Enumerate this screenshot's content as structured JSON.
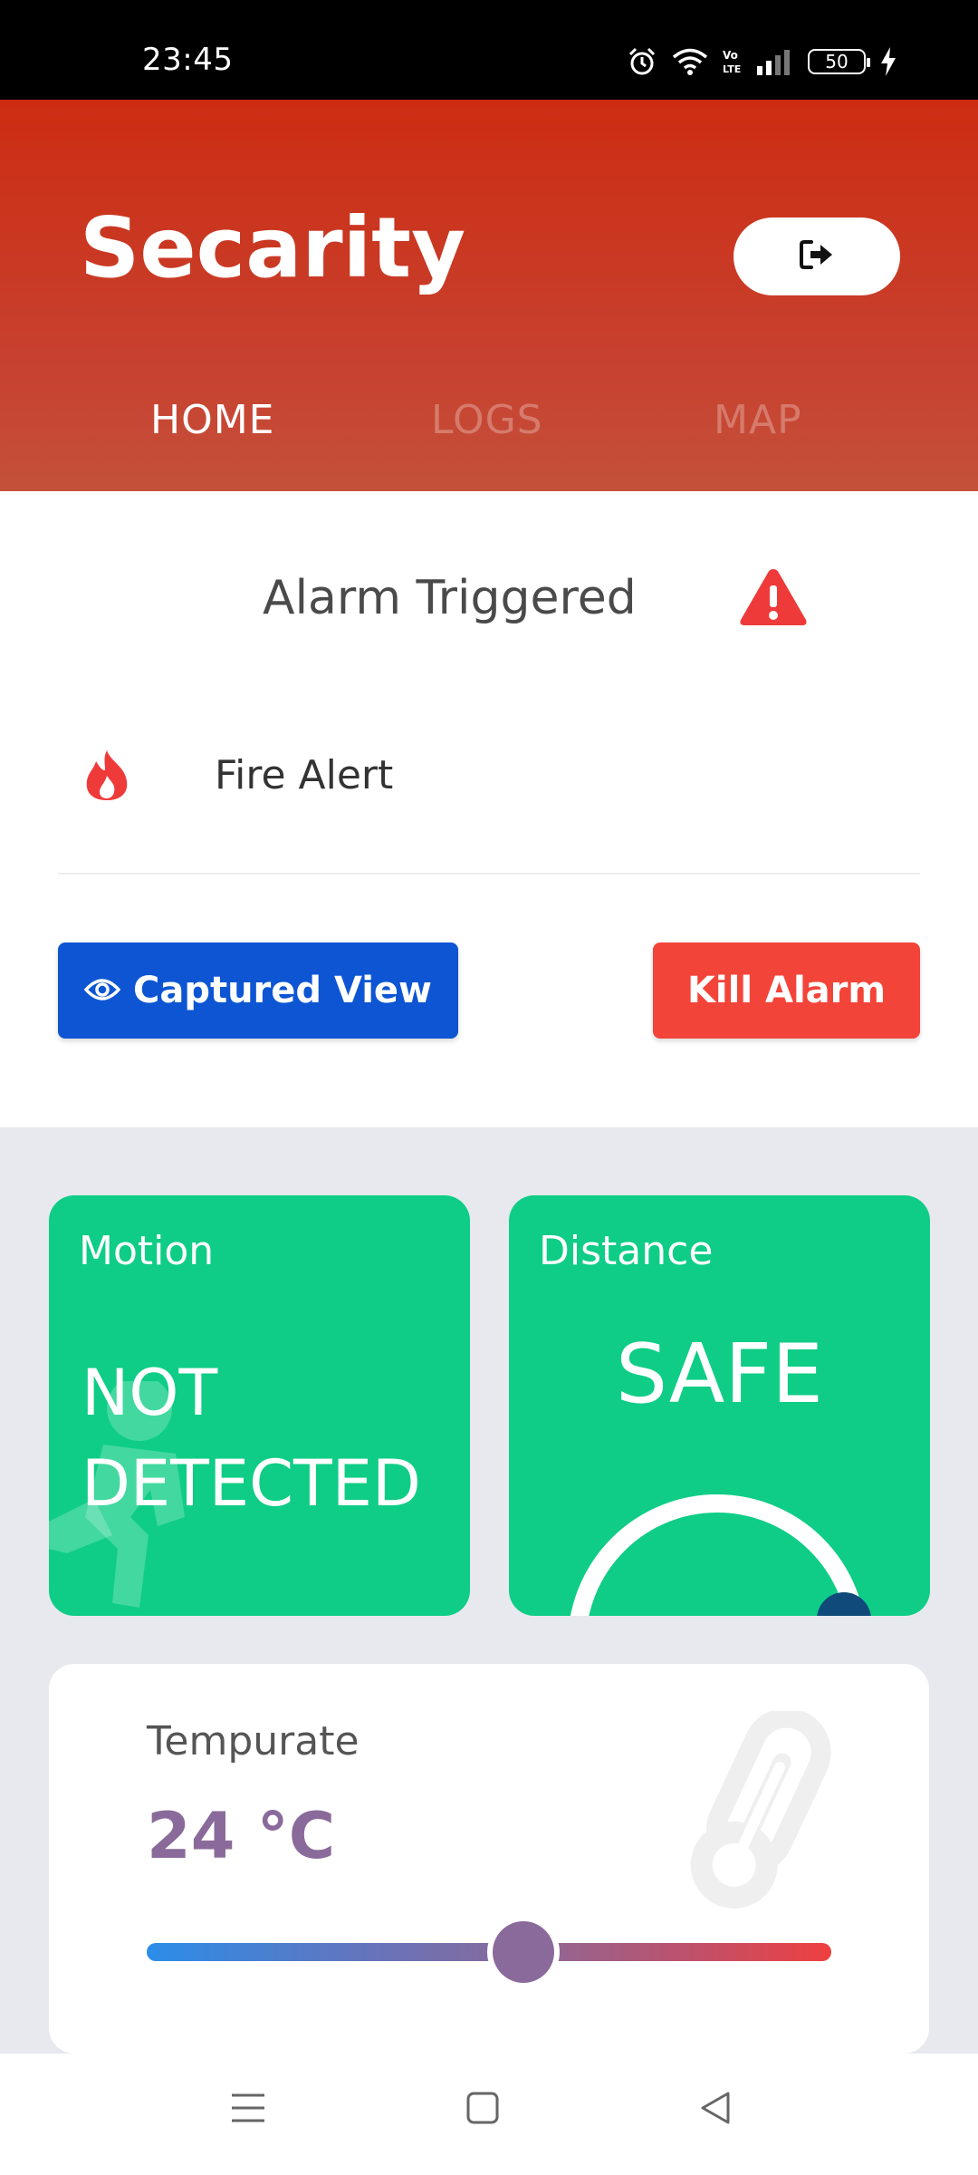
{
  "status_bar": {
    "time": "23:45",
    "battery": "50",
    "icons": [
      "alarm-clock-icon",
      "wifi-icon",
      "volte-icon",
      "signal-icon",
      "battery-icon",
      "charging-icon"
    ]
  },
  "header": {
    "title": "Secarity",
    "logout_icon": "logout-icon",
    "tabs": [
      {
        "label": "HOME",
        "active": true
      },
      {
        "label": "LOGS",
        "active": false
      },
      {
        "label": "MAP",
        "active": false
      }
    ]
  },
  "alarm": {
    "title": "Alarm Triggered",
    "title_icon": "warning-triangle-icon",
    "alert_label": "Fire Alert",
    "alert_icon": "fire-icon",
    "captured_view_label": "Captured View",
    "captured_view_icon": "eye-icon",
    "kill_alarm_label": "Kill Alarm"
  },
  "sensors": {
    "motion": {
      "label": "Motion",
      "value_line1": "NOT",
      "value_line2": "DETECTED"
    },
    "distance": {
      "label": "Distance",
      "value": "SAFE"
    }
  },
  "temperature": {
    "label": "Tempurate",
    "value": "24 °C",
    "slider_fraction": 0.55
  },
  "colors": {
    "header_red": "#cd2c12",
    "primary_blue": "#0d55d3",
    "alarm_red": "#f3443a",
    "sensor_green": "#0fcd86",
    "temp_purple": "#8a6a9a"
  },
  "nav": {
    "icons": [
      "menu-icon",
      "home-square-icon",
      "back-triangle-icon"
    ]
  }
}
